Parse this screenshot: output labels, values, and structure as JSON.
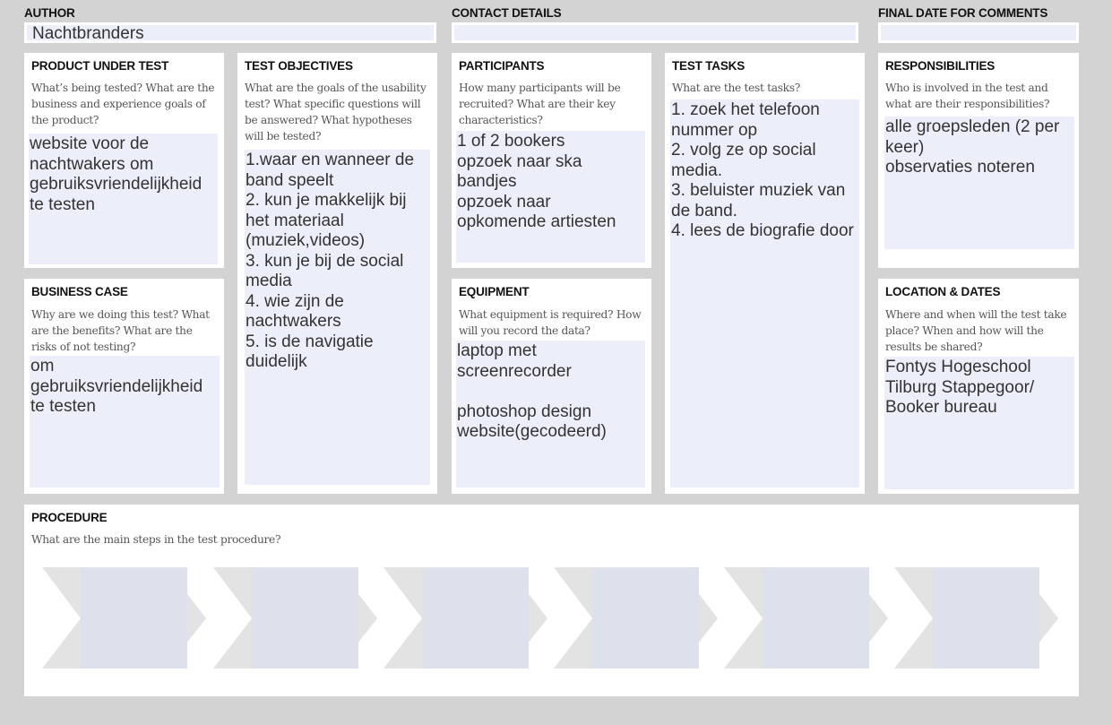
{
  "header": {
    "author_label": "AUTHOR",
    "author_value": "Nachtbranders",
    "contact_label": "CONTACT DETAILS",
    "contact_value": "",
    "final_date_label": "FINAL DATE FOR COMMENTS",
    "final_date_value": ""
  },
  "cards": {
    "product": {
      "title": "PRODUCT UNDER TEST",
      "question": "What’s being tested? What are the business and experience goals of the product?",
      "answer": "website voor de nachtwakers om gebruiksvriendelijkheid te testen"
    },
    "objectives": {
      "title": "TEST OBJECTIVES",
      "question": "What are the goals of the usability test? What specific questions will be answered? What hypotheses will be tested?",
      "answer": "1.waar en wanneer de band speelt\n2. kun je makkelijk bij het materiaal (muziek,videos)\n3. kun je bij de social media\n4. wie zijn de nachtwakers\n5. is de navigatie duidelijk"
    },
    "participants": {
      "title": "PARTICIPANTS",
      "question": "How many participants will be recruited? What are their key characteristics?",
      "answer": "1 of 2 bookers\nopzoek naar ska bandjes\nopzoek naar opkomende artiesten"
    },
    "tasks": {
      "title": "TEST TASKS",
      "question": "What are the test tasks?",
      "answer": "1. zoek het telefoon nummer op\n2. volg ze op social media.\n3. beluister muziek van de band.\n4. lees de biografie door"
    },
    "responsibilities": {
      "title": "RESPONSIBILITIES",
      "question": "Who is involved in the test and what are their responsibilities?",
      "answer": "alle groepsleden (2 per keer)\nobservaties noteren"
    },
    "business": {
      "title": "BUSINESS CASE",
      "question": "Why are we doing this test? What are the benefits? What are the risks of not testing?",
      "answer": "om gebruiksvriendelijkheid te testen"
    },
    "equipment": {
      "title": "EQUIPMENT",
      "question": "What equipment is required? How will you record the data?",
      "answer": "laptop met screenrecorder\n\nphotoshop design website(gecodeerd)"
    },
    "location": {
      "title": "LOCATION & DATES",
      "question": "Where and when will the test take place? When and how will the results be shared?",
      "answer": "Fontys Hogeschool Tilburg Stappegoor/ Booker bureau"
    },
    "procedure": {
      "title": "PROCEDURE",
      "question": "What are the main steps in the test procedure?"
    }
  },
  "colors": {
    "background": "#d3d3d3",
    "card": "#ffffff",
    "answer_fill": "#eceffa",
    "chevron_gray": "#e3e3e3",
    "chevron_blue": "#dde1ec"
  }
}
